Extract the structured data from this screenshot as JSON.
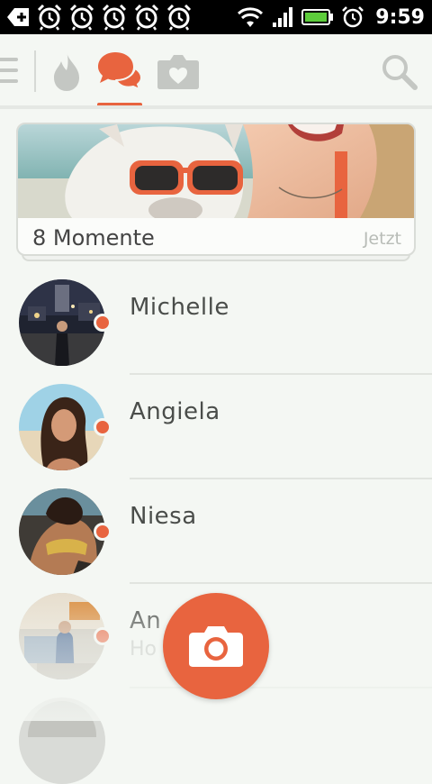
{
  "status_bar": {
    "time": "9:59",
    "notification_icons": [
      "add-notification-icon",
      "alarm-icon",
      "alarm-icon",
      "alarm-icon",
      "alarm-icon",
      "alarm-icon"
    ],
    "system_icons": [
      "wifi-icon",
      "signal-icon",
      "battery-icon",
      "alarm-clock-icon"
    ]
  },
  "toolbar": {
    "icons": [
      "menu-icon",
      "flame-icon",
      "chat-bubbles-icon",
      "camera-heart-icon",
      "search-icon"
    ],
    "active_tab": "chat-bubbles-icon"
  },
  "moments": {
    "label": "8 Momente",
    "time": "Jetzt"
  },
  "contacts": [
    {
      "name": "Michelle",
      "subtitle": "",
      "online": true
    },
    {
      "name": "Angiela",
      "subtitle": "",
      "online": true
    },
    {
      "name": "Niesa",
      "subtitle": "",
      "online": true
    },
    {
      "name": "An",
      "subtitle": "Ho",
      "online": true
    }
  ],
  "fab": {
    "icon": "camera-icon"
  },
  "colors": {
    "accent": "#e8643f",
    "background": "#f4f7f3",
    "inactive_icon": "#c4c7c3",
    "text": "#4a4d4a"
  }
}
